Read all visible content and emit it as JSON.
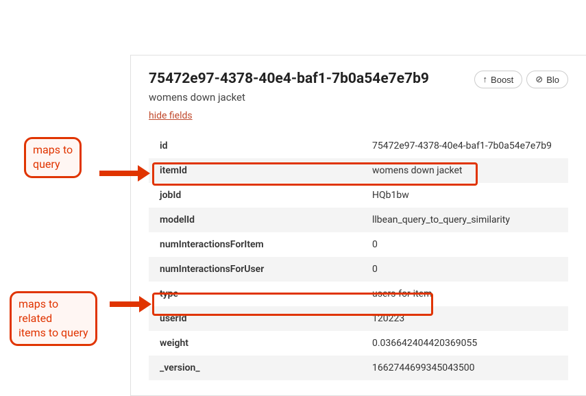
{
  "header": {
    "title": "75472e97-4378-40e4-baf1-7b0a54e7e7b9",
    "subtitle": "womens down jacket",
    "hide_fields_label": "hide fields",
    "boost_label": "Boost",
    "block_label": "Blo"
  },
  "fields": [
    {
      "key": "id",
      "value": "75472e97-4378-40e4-baf1-7b0a54e7e7b9"
    },
    {
      "key": "itemId",
      "value": "womens down jacket"
    },
    {
      "key": "jobId",
      "value": "HQb1bw"
    },
    {
      "key": "modelId",
      "value": "llbean_query_to_query_similarity"
    },
    {
      "key": "numInteractionsForItem",
      "value": "0"
    },
    {
      "key": "numInteractionsForUser",
      "value": "0"
    },
    {
      "key": "type",
      "value": "users-for-item"
    },
    {
      "key": "userId",
      "value": "120223"
    },
    {
      "key": "weight",
      "value": "0.036642404420369055"
    },
    {
      "key": "_version_",
      "value": "1662744699345043500"
    }
  ],
  "callouts": {
    "c1": "maps to\nquery",
    "c2": "maps to\nrelated\nitems to query"
  },
  "accent_color": "#e03400"
}
